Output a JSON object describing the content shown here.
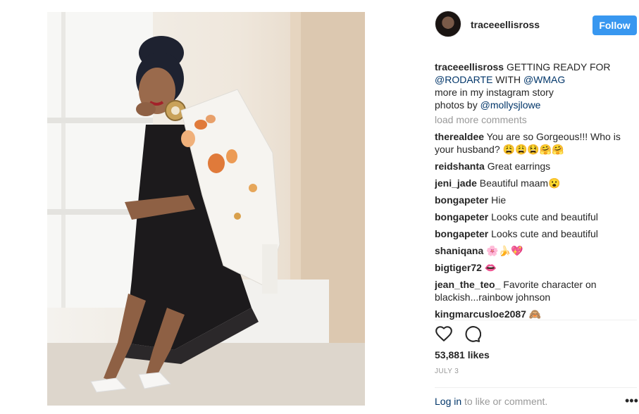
{
  "post": {
    "username": "traceeellisross",
    "follow_label": "Follow",
    "caption": {
      "username": "traceeellisross",
      "text_1": " GETTING READY FOR ",
      "mention_1": "@RODARTE",
      "text_2": " WITH ",
      "mention_2": "@WMAG",
      "line_2": "more in my instagram story",
      "line_3_prefix": "photos by ",
      "mention_3": "@mollysjlowe"
    },
    "load_more": "load more comments",
    "comments": [
      {
        "user": "therealdee",
        "text": " You are so Gorgeous!!! Who is your husband? 😩😩😫🤗🤗"
      },
      {
        "user": "reidshanta",
        "text": " Great earrings"
      },
      {
        "user": "jeni_jade",
        "text": " Beautiful maam😮"
      },
      {
        "user": "bongapeter",
        "text": " Hie"
      },
      {
        "user": "bongapeter",
        "text": " Looks cute and beautiful"
      },
      {
        "user": "bongapeter",
        "text": " Looks cute and beautiful"
      },
      {
        "user": "shaniqana",
        "text": " 🌸🍌💖"
      },
      {
        "user": "bigtiger72",
        "text": " 👄"
      },
      {
        "user": "jean_the_teo_",
        "text": " Favorite character on blackish...rainbow johnson"
      },
      {
        "user": "kingmarcusloe2087",
        "text": " 🙈"
      }
    ],
    "likes": "53,881 likes",
    "date": "JULY 3",
    "login_link": "Log in",
    "login_suffix": " to like or comment.",
    "more_label": "•••",
    "icons": {
      "like": "heart-icon",
      "comment": "comment-icon",
      "more": "more-options-icon"
    }
  }
}
